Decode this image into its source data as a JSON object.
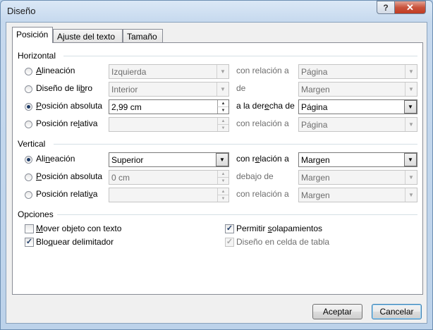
{
  "window": {
    "title": "Diseño",
    "help_label": "?",
    "close_label": "✕"
  },
  "tabs": [
    {
      "label": "Posición",
      "active": true
    },
    {
      "label": "Ajuste del texto",
      "active": false
    },
    {
      "label": "Tamaño",
      "active": false
    }
  ],
  "horizontal": {
    "title": "Horizontal",
    "rows": [
      {
        "label": "Alineación",
        "selected": false,
        "value": "Izquierda",
        "value_type": "combo",
        "enabled": false,
        "relation": "con relación a",
        "relation_enabled": false,
        "target": "Página",
        "target_enabled": false
      },
      {
        "label": "Diseño de libro",
        "selected": false,
        "value": "Interior",
        "value_type": "combo",
        "enabled": false,
        "relation": "de",
        "relation_enabled": false,
        "target": "Margen",
        "target_enabled": false
      },
      {
        "label": "Posición absoluta",
        "selected": true,
        "value": "2,99 cm",
        "value_type": "spin",
        "enabled": true,
        "relation": "a la derecha de",
        "relation_enabled": true,
        "target": "Página",
        "target_enabled": true
      },
      {
        "label": "Posición relativa",
        "selected": false,
        "value": "",
        "value_type": "spin",
        "enabled": false,
        "relation": "con relación a",
        "relation_enabled": false,
        "target": "Página",
        "target_enabled": false
      }
    ]
  },
  "vertical": {
    "title": "Vertical",
    "rows": [
      {
        "label": "Alineación",
        "selected": true,
        "value": "Superior",
        "value_type": "combo",
        "enabled": true,
        "relation": "con relación a",
        "relation_enabled": true,
        "target": "Margen",
        "target_enabled": true
      },
      {
        "label": "Posición absoluta",
        "selected": false,
        "value": "0 cm",
        "value_type": "spin",
        "enabled": false,
        "relation": "debajo de",
        "relation_enabled": false,
        "target": "Margen",
        "target_enabled": false
      },
      {
        "label": "Posición relativa",
        "selected": false,
        "value": "",
        "value_type": "spin",
        "enabled": false,
        "relation": "con relación a",
        "relation_enabled": false,
        "target": "Margen",
        "target_enabled": false
      }
    ]
  },
  "options": {
    "title": "Opciones",
    "items": [
      {
        "label": "Mover objeto con texto",
        "checked": false,
        "enabled": true
      },
      {
        "label": "Bloquear delimitador",
        "checked": true,
        "enabled": true
      },
      {
        "label": "Permitir solapamientos",
        "checked": true,
        "enabled": true
      },
      {
        "label": "Diseño en celda de tabla",
        "checked": true,
        "enabled": false
      }
    ]
  },
  "buttons": {
    "ok": "Aceptar",
    "cancel": "Cancelar"
  },
  "colors": {
    "title_bar": "#c6d9ee",
    "close_button": "#c13b22",
    "default_button_border": "#3c7fb1"
  },
  "icons": {
    "combo_arrow": "chevron-down-icon",
    "spin_up": "spin-up-icon",
    "spin_down": "spin-down-icon",
    "check": "checkmark-icon"
  }
}
